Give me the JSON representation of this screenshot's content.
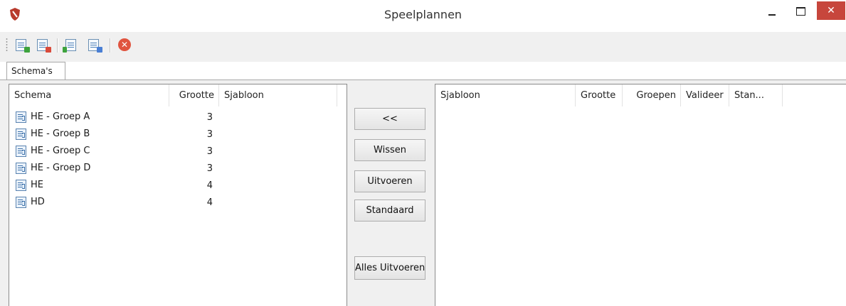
{
  "window": {
    "title": "Speelplannen",
    "close_glyph": "✕"
  },
  "toolbar": {
    "buttons": [
      {
        "icon": "schema-add-icon"
      },
      {
        "icon": "schema-remove-icon"
      },
      {
        "icon": "schema-import-icon"
      },
      {
        "icon": "schema-export-icon"
      },
      {
        "icon": "cancel-icon"
      }
    ],
    "cancel_glyph": "✕"
  },
  "tabs": [
    {
      "label": "Schema's"
    }
  ],
  "left_table": {
    "columns": [
      "Schema",
      "Grootte",
      "Sjabloon"
    ],
    "rows": [
      {
        "schema": "HE - Groep A",
        "grootte": "3",
        "sjabloon": ""
      },
      {
        "schema": "HE - Groep B",
        "grootte": "3",
        "sjabloon": ""
      },
      {
        "schema": "HE - Groep C",
        "grootte": "3",
        "sjabloon": ""
      },
      {
        "schema": "HE - Groep D",
        "grootte": "3",
        "sjabloon": ""
      },
      {
        "schema": "HE",
        "grootte": "4",
        "sjabloon": ""
      },
      {
        "schema": "HD",
        "grootte": "4",
        "sjabloon": ""
      }
    ]
  },
  "actions": {
    "back": "<<",
    "clear": "Wissen",
    "execute": "Uitvoeren",
    "default": "Standaard",
    "execute_all": "Alles Uitvoeren"
  },
  "right_table": {
    "columns": [
      "Sjabloon",
      "Grootte",
      "Groepen",
      "Valideer",
      "Stan..."
    ]
  },
  "colors": {
    "close_button": "#c7463c",
    "toolbar_bg": "#f0f0f0"
  }
}
